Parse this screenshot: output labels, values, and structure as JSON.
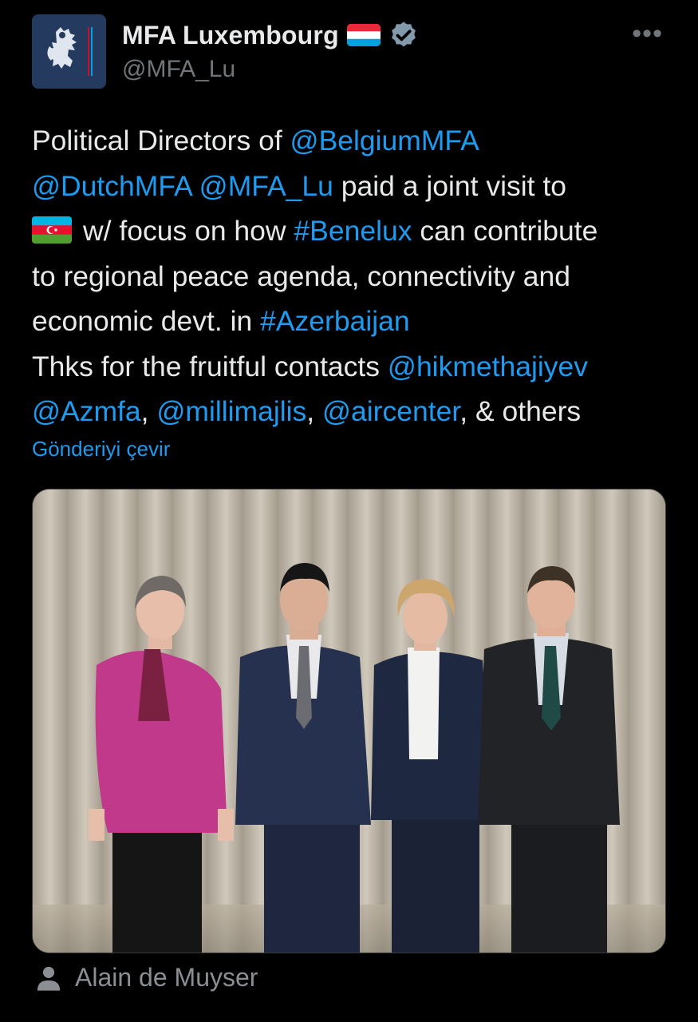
{
  "author": {
    "display_name": "MFA Luxembourg",
    "handle": "@MFA_Lu",
    "verified": true,
    "colors": {
      "verified_badge": "#829aab",
      "link": "#1d9bf0",
      "muted": "#71767b"
    }
  },
  "menu": {
    "more_label": "•••"
  },
  "tweet": {
    "l1_t1": "Political Directors of ",
    "l1_link1": "@BelgiumMFA",
    "l2_link1": "@DutchMFA",
    "l2_t1": " ",
    "l2_link2": "@MFA_Lu",
    "l2_t2": " paid a joint visit to",
    "l3_t1": "w/ focus on how ",
    "l3_link1": "#Benelux",
    "l3_t2": " can contribute",
    "l4_t1": "to regional peace agenda, connectivity and",
    "l5_t1": "economic devt. in ",
    "l5_link1": "#Azerbaijan",
    "l6_t1": "Thks for the fruitful contacts ",
    "l6_link1": "@hikmethajiyev",
    "l7_link1": "@Azmfa",
    "l7_t1": ", ",
    "l7_link2": "@millimajlis",
    "l7_t2": ", ",
    "l7_link3": "@aircenter",
    "l7_t3": ", & others",
    "flag_icon": "azerbaijan-flag-icon"
  },
  "translate_label": "Gönderiyi çevir",
  "media": {
    "type": "photo",
    "tagged_person": "Alain de Muyser"
  }
}
